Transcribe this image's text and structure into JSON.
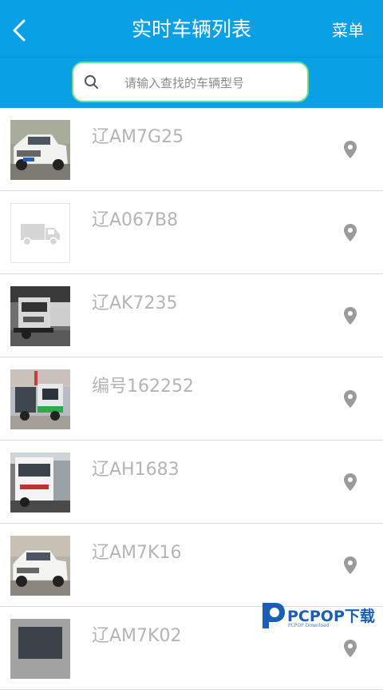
{
  "header": {
    "title": "实时车辆列表",
    "menu_label": "菜单",
    "color": "#0aa0e6"
  },
  "search": {
    "placeholder": "请输入查找的车辆型号",
    "value": ""
  },
  "vehicles": [
    {
      "plate": "辽AM7G25",
      "thumb": "white-pickup"
    },
    {
      "plate": "辽A067B8",
      "thumb": "truck-placeholder"
    },
    {
      "plate": "辽AK7235",
      "thumb": "sweeper-truck"
    },
    {
      "plate": "编号162252",
      "thumb": "small-sweeper"
    },
    {
      "plate": "辽AH1683",
      "thumb": "white-truck"
    },
    {
      "plate": "辽AM7K16",
      "thumb": "white-pickup"
    },
    {
      "plate": "辽AM7K02",
      "thumb": "vehicle"
    }
  ],
  "watermark": {
    "brand": "PCPOP下载",
    "sub": "PCPOP Download"
  }
}
